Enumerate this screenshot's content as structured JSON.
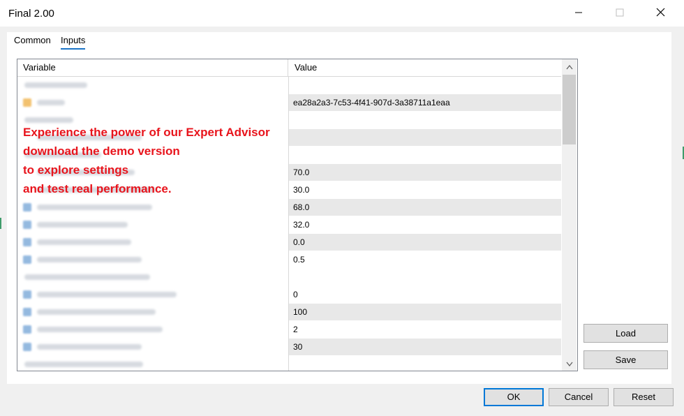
{
  "window": {
    "title": "Final 2.00",
    "min_icon": "minimize-icon",
    "max_icon": "maximize-icon",
    "close_icon": "close-icon"
  },
  "tabs": [
    {
      "label": "Common",
      "active": false
    },
    {
      "label": "Inputs",
      "active": true
    }
  ],
  "grid": {
    "columns": [
      "Variable",
      "Value"
    ],
    "rows": [
      {
        "value": "",
        "kind": "group"
      },
      {
        "value": "ea28a2a3-7c53-4f41-907d-3a38711a1eaa",
        "kind": "param",
        "icon": "abc-icon"
      },
      {
        "value": "",
        "kind": "group"
      },
      {
        "value": "",
        "kind": "param"
      },
      {
        "value": "",
        "kind": "group"
      },
      {
        "value": "70.0",
        "kind": "param"
      },
      {
        "value": "30.0",
        "kind": "param"
      },
      {
        "value": "68.0",
        "kind": "param",
        "icon": "double-icon"
      },
      {
        "value": "32.0",
        "kind": "param",
        "icon": "double-icon"
      },
      {
        "value": "0.0",
        "kind": "param",
        "icon": "double-icon"
      },
      {
        "value": "0.5",
        "kind": "param",
        "icon": "double-icon"
      },
      {
        "value": "",
        "kind": "group"
      },
      {
        "value": "0",
        "kind": "param",
        "icon": "integer-icon"
      },
      {
        "value": "100",
        "kind": "param",
        "icon": "integer-icon"
      },
      {
        "value": "2",
        "kind": "param",
        "icon": "integer-icon"
      },
      {
        "value": "30",
        "kind": "param",
        "icon": "integer-icon"
      },
      {
        "value": "",
        "kind": "group"
      }
    ]
  },
  "promo": {
    "lines": [
      "Experience the power of our Expert Advisor",
      "download the demo version",
      "to explore settings",
      "and test real performance."
    ],
    "color": "#e8141c"
  },
  "buttons": {
    "load": "Load",
    "save": "Save",
    "ok": "OK",
    "cancel": "Cancel",
    "reset": "Reset"
  },
  "colors": {
    "accent": "#0078d7",
    "row_alt": "#e8e8e8"
  }
}
